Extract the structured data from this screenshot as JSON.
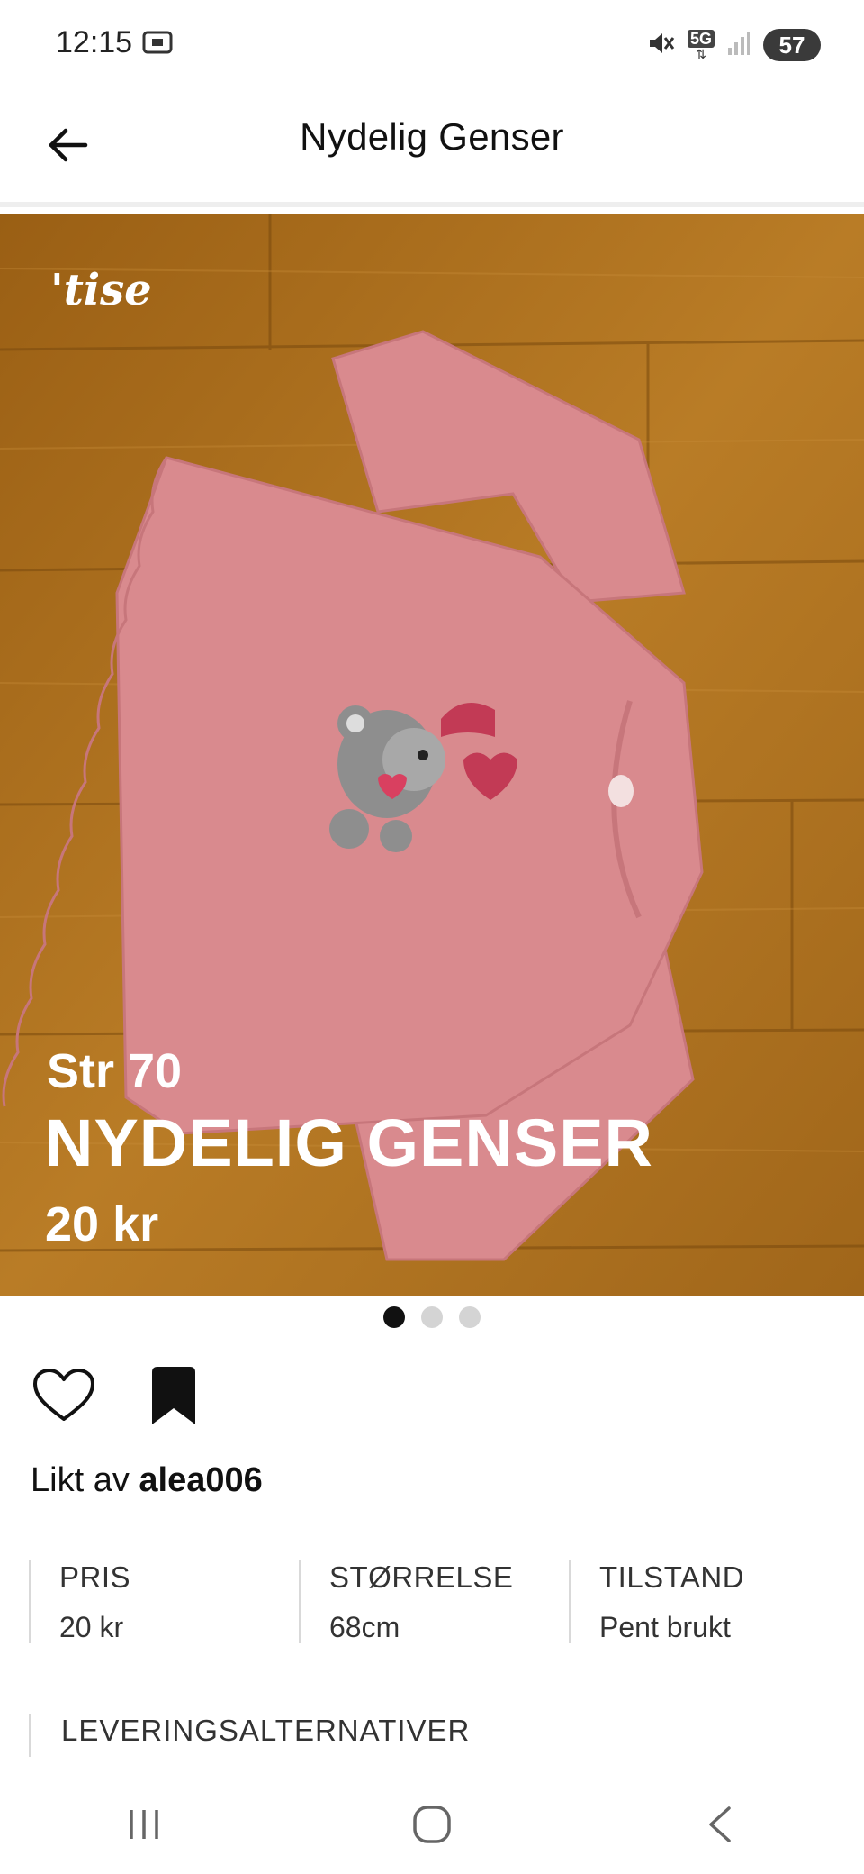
{
  "status_bar": {
    "time": "12:15",
    "network": "5G",
    "battery": "57",
    "icons": [
      "screenshot-icon",
      "mute-icon",
      "network-5g-icon",
      "signal-icon",
      "battery-icon"
    ]
  },
  "header": {
    "title": "Nydelig Genser",
    "back_icon": "arrow-left-icon"
  },
  "carousel": {
    "logo": "'tise",
    "overlay": {
      "size": "Str 70",
      "title": "NYDELIG GENSER",
      "price": "20 kr"
    },
    "page_count": 3,
    "active_index": 0
  },
  "actions": {
    "like_icon": "heart-outline-icon",
    "save_icon": "bookmark-icon"
  },
  "liked_by": {
    "prefix": "Likt av",
    "user": "alea006"
  },
  "details": [
    {
      "label": "PRIS",
      "value": "20 kr"
    },
    {
      "label": "STØRRELSE",
      "value": "68cm"
    },
    {
      "label": "TILSTAND",
      "value": "Pent brukt"
    }
  ],
  "delivery": {
    "label": "LEVERINGSALTERNATIVER"
  },
  "nav_bar": {
    "icons": [
      "recent-apps-icon",
      "home-icon",
      "back-icon"
    ]
  },
  "colors": {
    "background": "#ffffff",
    "wood": "#b5781f",
    "sweater": "#d98a8e",
    "text": "#111111"
  }
}
